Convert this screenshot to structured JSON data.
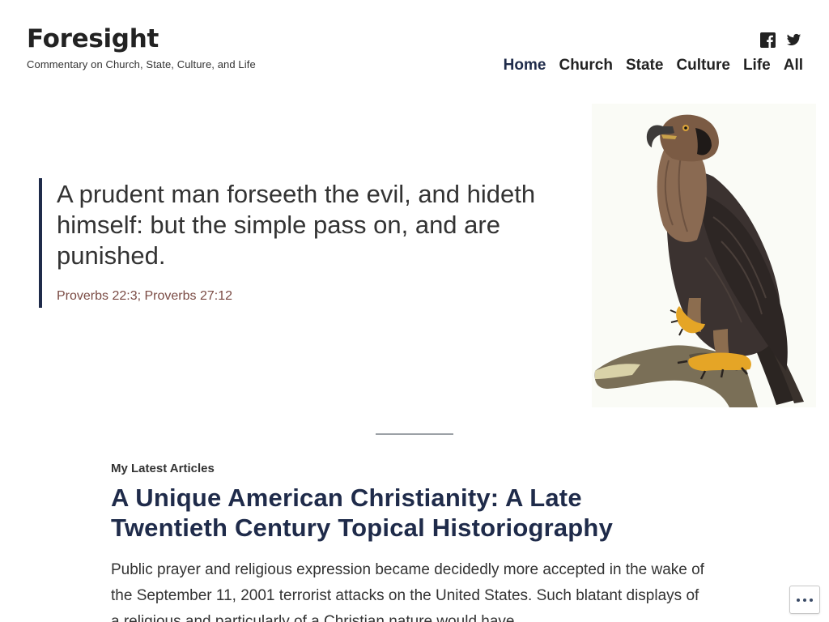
{
  "site": {
    "title": "Foresight",
    "tagline": "Commentary on Church, State, Culture, and Life"
  },
  "social": [
    {
      "icon": "facebook-icon"
    },
    {
      "icon": "twitter-icon"
    }
  ],
  "nav": {
    "items": [
      {
        "label": "Home",
        "current": true
      },
      {
        "label": "Church"
      },
      {
        "label": "State"
      },
      {
        "label": "Culture"
      },
      {
        "label": "Life"
      },
      {
        "label": "All"
      }
    ]
  },
  "hero": {
    "quote": "A prudent man forseeth the evil, and hideth himself: but the simple pass on, and are punished.",
    "citation": "Proverbs 22:3; Proverbs 27:12",
    "image": "eagle-illustration"
  },
  "latest": {
    "label": "My Latest Articles",
    "title": "A Unique American Christianity: A Late Twentieth Century Topical Historiography",
    "excerpt": "Public prayer and religious expression became decidedly more accepted in the wake of the September 11, 2001 terrorist attacks on the United States. Such blatant displays of a religious and particularly of a Christian nature would have"
  },
  "colors": {
    "accent": "#1f2b4a",
    "citation": "#7a4a43"
  }
}
